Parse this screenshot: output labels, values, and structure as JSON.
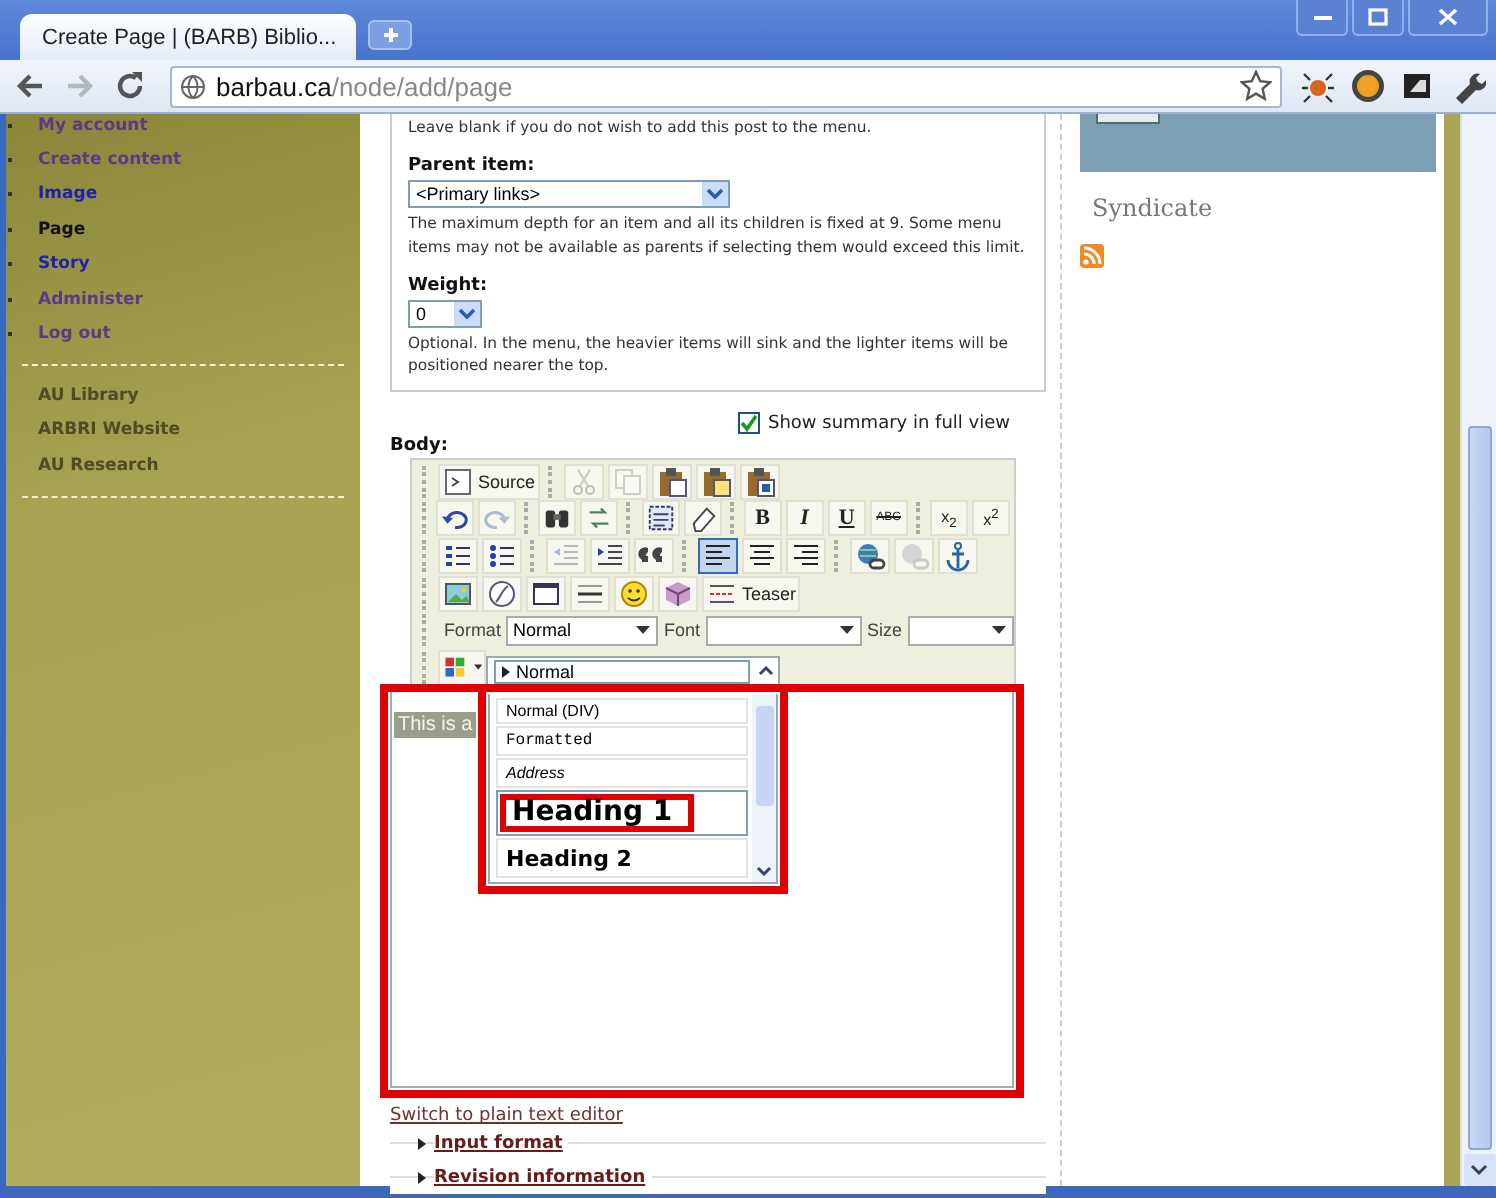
{
  "browser": {
    "tab_title": "Create Page | (BARB) Biblio...",
    "nav": [
      {
        "kind": "back",
        "disabled": false
      },
      {
        "kind": "forward",
        "disabled": true
      },
      {
        "kind": "reload",
        "disabled": false
      }
    ],
    "url_host": "barbau.ca",
    "url_path": "/node/add/page"
  },
  "sidebar": {
    "items": [
      {
        "label": "My account",
        "kind": "visited"
      },
      {
        "label": "Create content",
        "kind": "visited"
      },
      {
        "label": "Image",
        "kind": "link"
      },
      {
        "label": "Page",
        "kind": "active"
      },
      {
        "label": "Story",
        "kind": "link"
      },
      {
        "label": "Administer",
        "kind": "visited"
      },
      {
        "label": "Log out",
        "kind": "visited"
      }
    ],
    "links": [
      {
        "label": "AU Library"
      },
      {
        "label": "ARBRI Website"
      },
      {
        "label": "AU Research"
      }
    ]
  },
  "menu_settings": {
    "hint": "Leave blank if you do not wish to add this post to the menu.",
    "parent_label": "Parent item:",
    "parent_value": "<Primary links>",
    "parent_help": "The maximum depth for an item and all its children is fixed at 9. Some menu items may not be available as parents if selecting them would exceed this limit.",
    "weight_label": "Weight:",
    "weight_value": "0",
    "weight_help": "Optional. In the menu, the heavier items will sink and the lighter items will be positioned nearer the top."
  },
  "body": {
    "summary": {
      "label": "Show summary in full view",
      "checked": true
    },
    "label": "Body:",
    "toolbar": [
      [
        [
          {
            "kind": "source",
            "label": "Source",
            "disabled": false,
            "on": false
          }
        ],
        [
          {
            "kind": "cut",
            "disabled": true,
            "on": false
          },
          {
            "kind": "copy",
            "disabled": true,
            "on": false
          },
          {
            "kind": "paste",
            "disabled": false,
            "on": false
          },
          {
            "kind": "paste-text",
            "disabled": false,
            "on": false
          },
          {
            "kind": "paste-word",
            "disabled": false,
            "on": false
          }
        ]
      ],
      [
        [
          {
            "kind": "undo",
            "disabled": false,
            "on": false
          },
          {
            "kind": "redo",
            "disabled": true,
            "on": false
          }
        ],
        [
          {
            "kind": "find",
            "disabled": false,
            "on": false
          },
          {
            "kind": "replace",
            "disabled": false,
            "on": false
          }
        ],
        [
          {
            "kind": "select-all",
            "disabled": false,
            "on": false
          },
          {
            "kind": "remove-format",
            "disabled": false,
            "on": false
          }
        ],
        [
          {
            "kind": "bold",
            "label": "B",
            "disabled": false,
            "on": false
          },
          {
            "kind": "italic",
            "label": "I",
            "disabled": false,
            "on": false
          },
          {
            "kind": "underline",
            "label": "U",
            "disabled": false,
            "on": false
          },
          {
            "kind": "strike",
            "label": "ABC",
            "disabled": false,
            "on": false
          }
        ],
        [
          {
            "kind": "subscript",
            "label": "x$_{2}$",
            "disabled": false,
            "on": false
          },
          {
            "kind": "superscript",
            "label": "x$^{2}$",
            "disabled": false,
            "on": false
          }
        ]
      ],
      [
        [
          {
            "kind": "ol",
            "disabled": false,
            "on": false
          },
          {
            "kind": "ul",
            "disabled": false,
            "on": false
          }
        ],
        [
          {
            "kind": "outdent",
            "disabled": true,
            "on": false
          },
          {
            "kind": "indent",
            "disabled": false,
            "on": false
          },
          {
            "kind": "blockquote",
            "disabled": false,
            "on": false
          }
        ],
        [
          {
            "kind": "align-left",
            "disabled": false,
            "on": true
          },
          {
            "kind": "align-center",
            "disabled": false,
            "on": false
          },
          {
            "kind": "align-right",
            "disabled": false,
            "on": false
          }
        ],
        [
          {
            "kind": "link",
            "disabled": false,
            "on": false
          },
          {
            "kind": "unlink",
            "disabled": true,
            "on": false
          },
          {
            "kind": "anchor",
            "disabled": false,
            "on": false
          }
        ]
      ],
      [
        [
          {
            "kind": "image",
            "disabled": false,
            "on": false
          },
          {
            "kind": "flash",
            "disabled": false,
            "on": false
          },
          {
            "kind": "frame",
            "disabled": false,
            "on": false
          },
          {
            "kind": "hr",
            "disabled": false,
            "on": false
          },
          {
            "kind": "smiley",
            "disabled": false,
            "on": false
          },
          {
            "kind": "special-char",
            "disabled": false,
            "on": false
          },
          {
            "kind": "teaser",
            "label": "Teaser",
            "disabled": false,
            "on": false
          }
        ]
      ]
    ],
    "combos": [
      {
        "label": "Format",
        "value": "Normal",
        "kind": "format"
      },
      {
        "label": "Font",
        "kind": "font"
      },
      {
        "label": "Size",
        "kind": "size"
      }
    ],
    "format_menu": {
      "open": true,
      "current": "Normal",
      "items": [
        {
          "label": "Normal (DIV)",
          "kind": "div",
          "selected": false
        },
        {
          "label": "Formatted",
          "kind": "pre",
          "selected": false
        },
        {
          "label": "Address",
          "kind": "address",
          "selected": false
        },
        {
          "label": "Heading 1",
          "kind": "h1",
          "selected": true
        },
        {
          "label": "Heading 2",
          "kind": "h2",
          "selected": false
        }
      ]
    },
    "content": "This is a"
  },
  "switch_link": "Switch to plain text editor",
  "fieldsets": [
    {
      "legend": "Input format",
      "expanded": false
    },
    {
      "legend": "Revision information",
      "expanded": false
    }
  ],
  "right": {
    "heading": "Syndicate"
  },
  "annotations": {
    "editor_frame": true,
    "menu_frame": true,
    "item_frame": true
  }
}
